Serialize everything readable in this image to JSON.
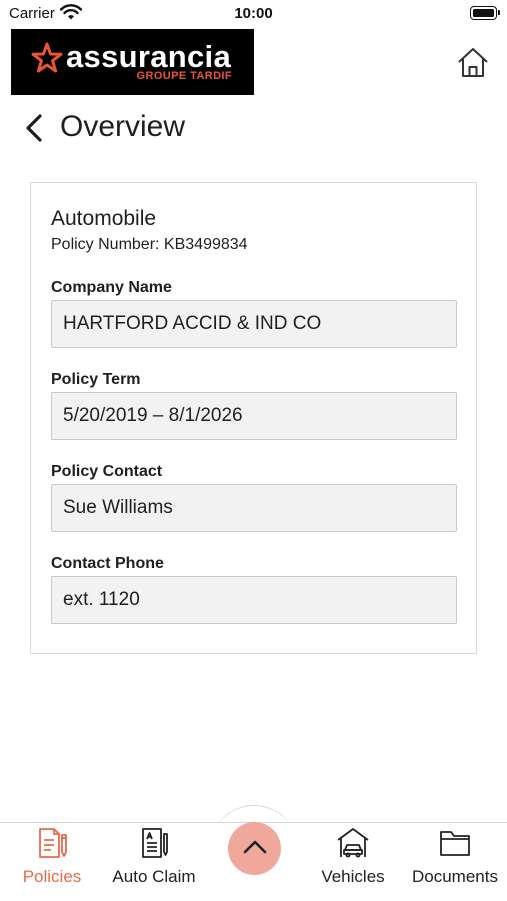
{
  "status_bar": {
    "carrier": "Carrier",
    "time": "10:00"
  },
  "header": {
    "logo_name": "assurancia",
    "logo_subtitle": "GROUPE TARDIF"
  },
  "nav": {
    "title": "Overview"
  },
  "policy": {
    "type": "Automobile",
    "number_line": "Policy Number: KB3499834",
    "fields": [
      {
        "label": "Company Name",
        "value": "HARTFORD ACCID & IND CO"
      },
      {
        "label": "Policy Term",
        "value": "5/20/2019 – 8/1/2026"
      },
      {
        "label": "Policy Contact",
        "value": "Sue Williams"
      },
      {
        "label": "Contact Phone",
        "value": "ext. 1120"
      }
    ]
  },
  "tabbar": {
    "tabs": [
      {
        "label": "Policies",
        "icon": "document-pen-icon",
        "active": true
      },
      {
        "label": "Auto Claim",
        "icon": "claim-form-icon",
        "active": false
      },
      {
        "label": "Vehicles",
        "icon": "car-garage-icon",
        "active": false
      },
      {
        "label": "Documents",
        "icon": "folder-icon",
        "active": false
      }
    ],
    "center_button_icon": "chevron-up-icon"
  },
  "colors": {
    "accent": "#e8694a",
    "fab": "#f0a89d",
    "logo_bg": "#000000",
    "logo_subtitle": "#e8572e",
    "field_bg": "#f2f2f2"
  }
}
